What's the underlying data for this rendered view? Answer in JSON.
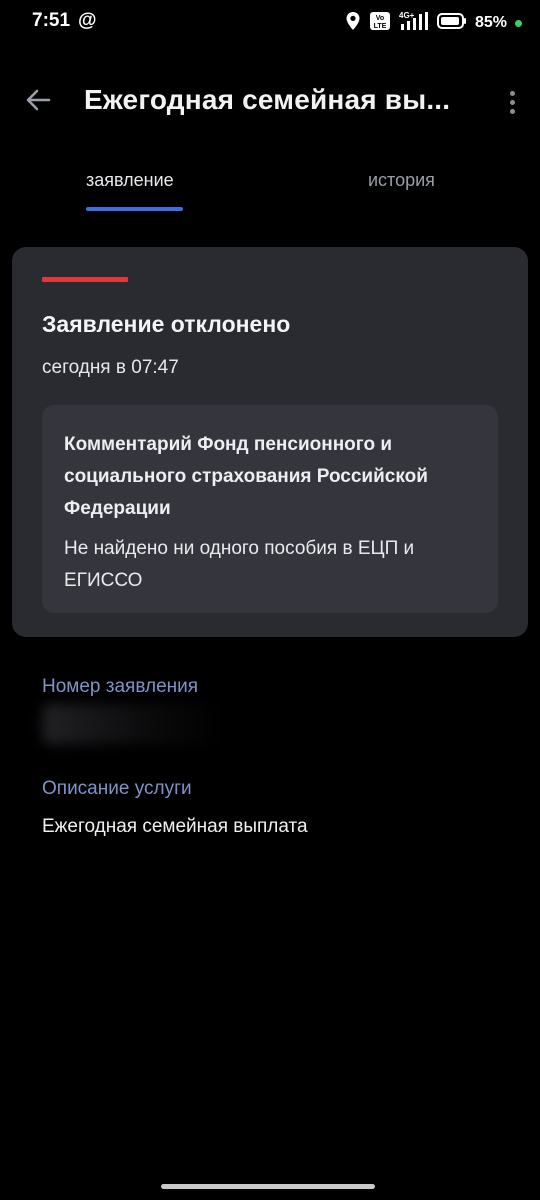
{
  "status_bar": {
    "time": "7:51",
    "at_symbol": "@",
    "network_label": "4G+",
    "volte_label": "Vo LTE",
    "battery_percent": "85%",
    "icons": [
      "location-icon",
      "volte-icon",
      "signal-icon",
      "battery-icon"
    ]
  },
  "app_bar": {
    "title": "Ежегодная семейная вы...",
    "back_icon": "arrow-left-icon",
    "more_icon": "more-vertical-icon"
  },
  "tabs": [
    {
      "label": "заявление",
      "active": true
    },
    {
      "label": "история",
      "active": false
    }
  ],
  "status_card": {
    "accent_color": "#e0393b",
    "title": "Заявление отклонено",
    "time": "сегодня в 07:47",
    "comment": {
      "title": "Комментарий Фонд пенсионного и социального страхования Российской Федерации",
      "text": "Не найдено ни одного пособия в ЕЦП и ЕГИССО"
    }
  },
  "fields": {
    "application_number": {
      "label": "Номер заявления",
      "value": ""
    },
    "service_description": {
      "label": "Описание услуги",
      "value": "Ежегодная семейная выплата"
    }
  },
  "colors": {
    "background": "#000000",
    "card": "#2a2b31",
    "tab_indicator": "#3d6fe0",
    "field_label": "#7e93c9"
  }
}
